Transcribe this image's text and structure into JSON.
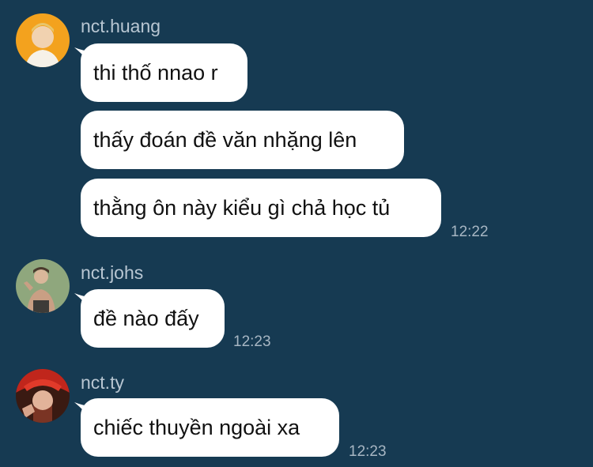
{
  "groups": [
    {
      "sender": "nct.huang",
      "avatar_icon": "profile-photo-orange",
      "messages": [
        "thi thố nnao r",
        "thấy đoán đề văn nhặng lên",
        "thằng ôn này kiểu gì chả học tủ"
      ],
      "time": "12:22"
    },
    {
      "sender": "nct.johs",
      "avatar_icon": "profile-photo-green",
      "messages": [
        "đề nào đấy"
      ],
      "time": "12:23"
    },
    {
      "sender": "nct.ty",
      "avatar_icon": "profile-photo-red",
      "messages": [
        "chiếc thuyền ngoài xa"
      ],
      "time": "12:23"
    }
  ],
  "colors": {
    "background": "#163a52",
    "bubble": "#ffffff",
    "sender_text": "#b8c6d2",
    "time_text": "#a7b6c3"
  }
}
